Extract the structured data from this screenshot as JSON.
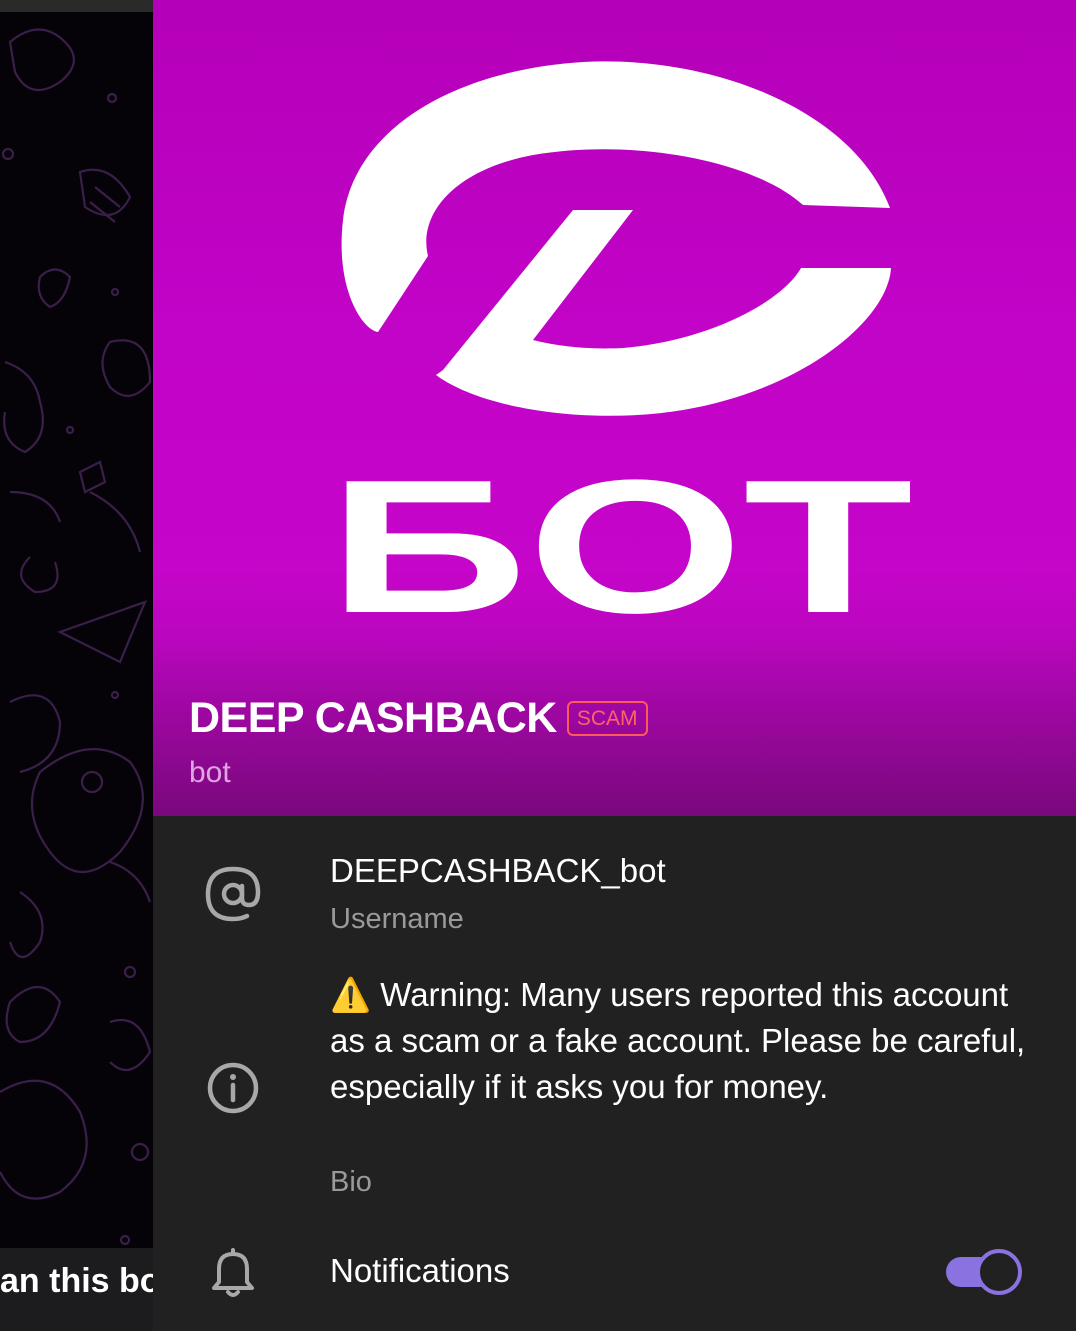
{
  "chat_background": {
    "cut_off_text": "an this bo"
  },
  "profile": {
    "logo_text": "БОТ",
    "name": "DEEP CASHBACK",
    "badge": "SCAM",
    "subtitle": "bot",
    "brand_color": "#c505c9"
  },
  "info": {
    "username": {
      "value": "DEEPCASHBACK_bot",
      "label": "Username",
      "icon": "at-icon"
    },
    "bio": {
      "warning_icon": "⚠️",
      "value": "Warning: Many users reported this account as a scam or a fake account. Please be careful, especially if it asks you for money.",
      "label": "Bio",
      "icon": "info-icon"
    },
    "notifications": {
      "label": "Notifications",
      "enabled": true,
      "icon": "bell-icon",
      "toggle_color": "#8a72e0"
    }
  }
}
